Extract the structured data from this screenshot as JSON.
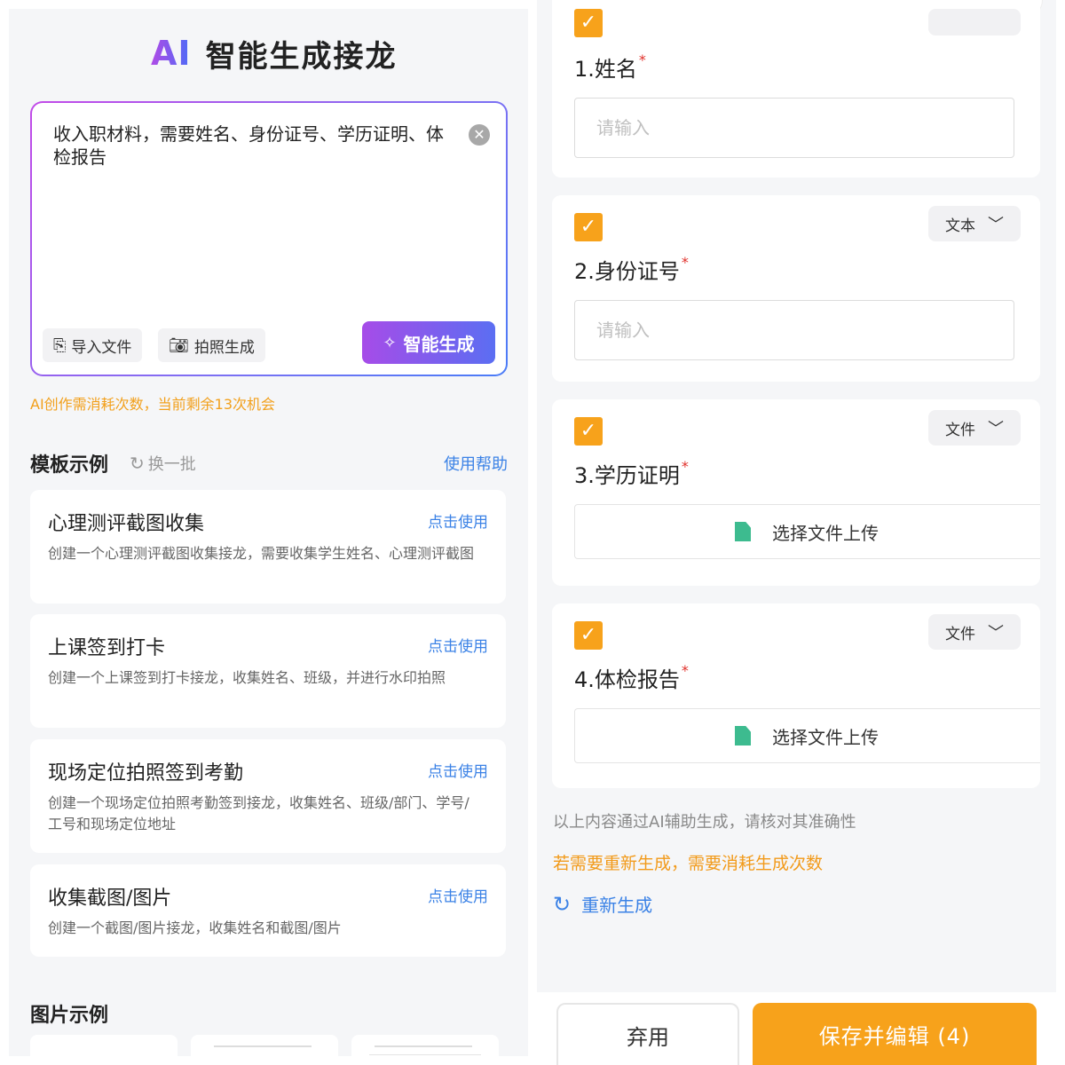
{
  "left": {
    "logo_text": "AI",
    "title": "智能生成接龙",
    "prompt_text": "收入职材料，需要姓名、身份证号、学历证明、体检报告",
    "clear_icon": "close-circle-icon",
    "import_label": "导入文件",
    "photo_label": "拍照生成",
    "generate_label": "智能生成",
    "quota_text": "AI创作需消耗次数，当前剩余13次机会",
    "templates_title": "模板示例",
    "refresh_label": "换一批",
    "help_label": "使用帮助",
    "templates": [
      {
        "title": "心理测评截图收集",
        "use": "点击使用",
        "desc": "创建一个心理测评截图收集接龙，需要收集学生姓名、心理测评截图"
      },
      {
        "title": "上课签到打卡",
        "use": "点击使用",
        "desc": "创建一个上课签到打卡接龙，收集姓名、班级，并进行水印拍照"
      },
      {
        "title": "现场定位拍照签到考勤",
        "use": "点击使用",
        "desc": "创建一个现场定位拍照考勤签到接龙，收集姓名、班级/部门、学号/工号和现场定位地址"
      },
      {
        "title": "收集截图/图片",
        "use": "点击使用",
        "desc": "创建一个截图/图片接龙，收集姓名和截图/图片"
      }
    ],
    "images_title": "图片示例"
  },
  "right": {
    "fields": [
      {
        "label": "1.姓名",
        "required": "*",
        "type": "",
        "kind": "text",
        "placeholder": "请输入"
      },
      {
        "label": "2.身份证号",
        "required": "*",
        "type": "文本",
        "kind": "text",
        "placeholder": "请输入"
      },
      {
        "label": "3.学历证明",
        "required": "*",
        "type": "文件",
        "kind": "file",
        "upload": "选择文件上传"
      },
      {
        "label": "4.体检报告",
        "required": "*",
        "type": "文件",
        "kind": "file",
        "upload": "选择文件上传"
      }
    ],
    "note_verify": "以上内容通过AI辅助生成，请核对其准确性",
    "note_cost": "若需要重新生成，需要消耗生成次数",
    "regenerate_label": "重新生成",
    "discard_label": "弃用",
    "save_label": "保存并编辑 (4)"
  },
  "colors": {
    "accent_orange": "#f7a21b",
    "link_blue": "#3b82e6",
    "gradient_purple": "#a64ce8",
    "gradient_blue": "#5b6ef2",
    "required_red": "#e0302a"
  }
}
